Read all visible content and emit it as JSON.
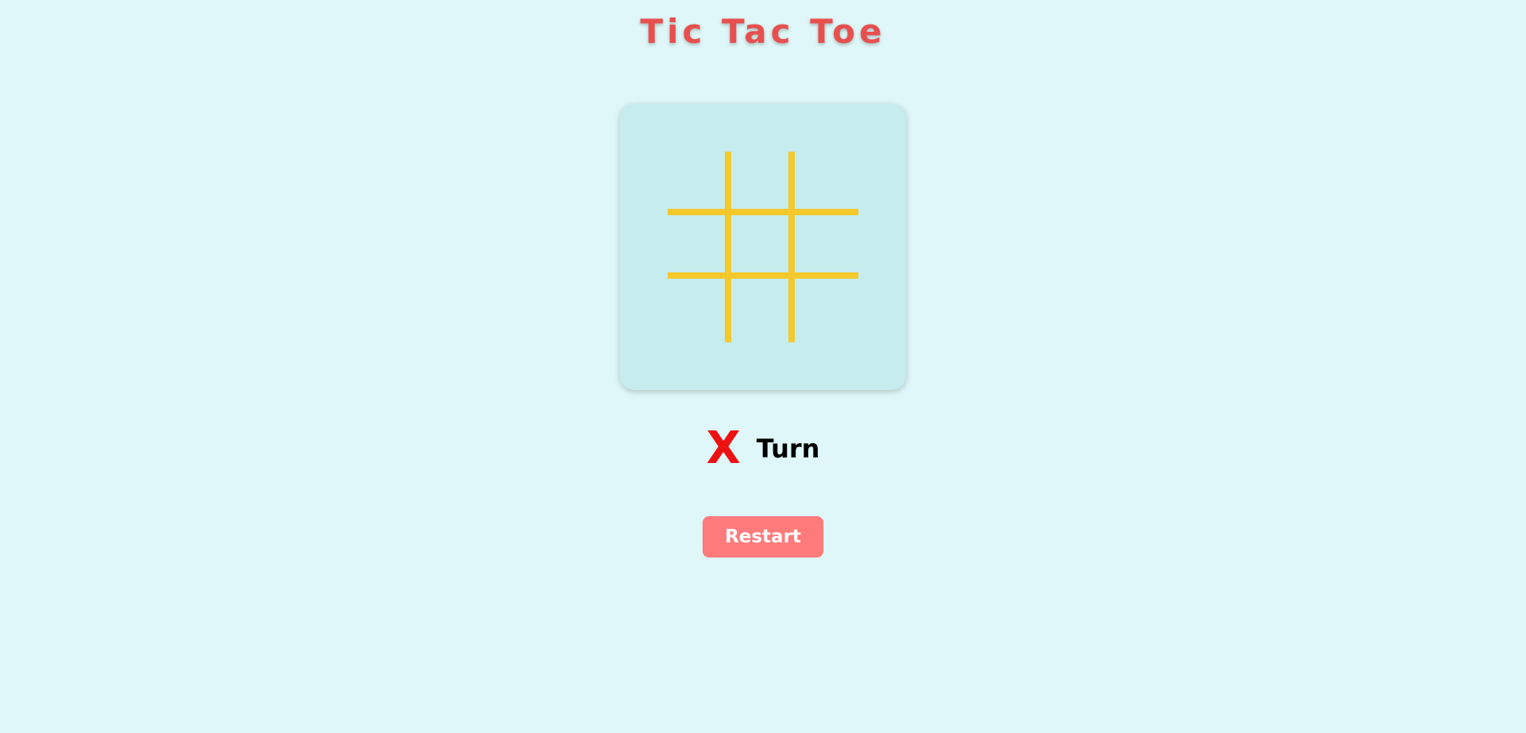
{
  "title": "Tic Tac Toe",
  "board": {
    "cells": [
      "",
      "",
      "",
      "",
      "",
      "",
      "",
      "",
      ""
    ],
    "line_color": "#f4c92c",
    "background_color": "#c6eced"
  },
  "status": {
    "current_player": "X",
    "turn_label": "Turn",
    "player_color": "#ee1111"
  },
  "controls": {
    "restart_label": "Restart",
    "restart_color": "#ff7b7b"
  },
  "colors": {
    "page_background": "#dff7f8",
    "title": "#e85050"
  }
}
